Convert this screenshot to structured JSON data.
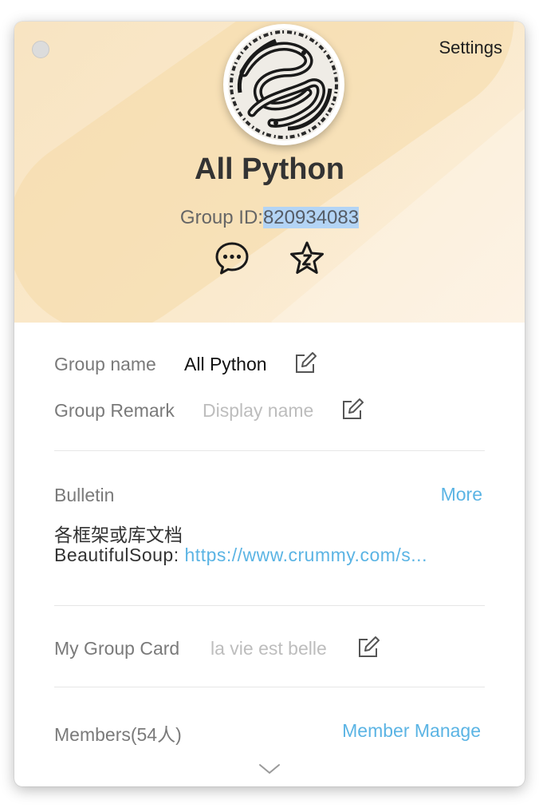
{
  "header": {
    "settings_label": "Settings",
    "group_title": "All Python",
    "group_id_label": "Group ID:",
    "group_id_value": "820934083",
    "colors": {
      "header_bg": "#fae9cb",
      "selection": "#b3d4f5"
    },
    "icons": [
      "chat-bubble-icon",
      "star-icon"
    ]
  },
  "info": {
    "group_name_label": "Group name",
    "group_name_value": "All Python",
    "group_remark_label": "Group Remark",
    "group_remark_placeholder": "Display name"
  },
  "bulletin": {
    "label": "Bulletin",
    "more_label": "More",
    "line1": "各框架或库文档",
    "line2_prefix": "BeautifulSoup: ",
    "line2_url": "https://www.crummy.com/s..."
  },
  "group_card": {
    "label": "My Group Card",
    "value": "la vie est belle"
  },
  "members": {
    "label": "Members(54人)",
    "manage_label": "Member Manage"
  },
  "accent_color": "#5bb4e4"
}
